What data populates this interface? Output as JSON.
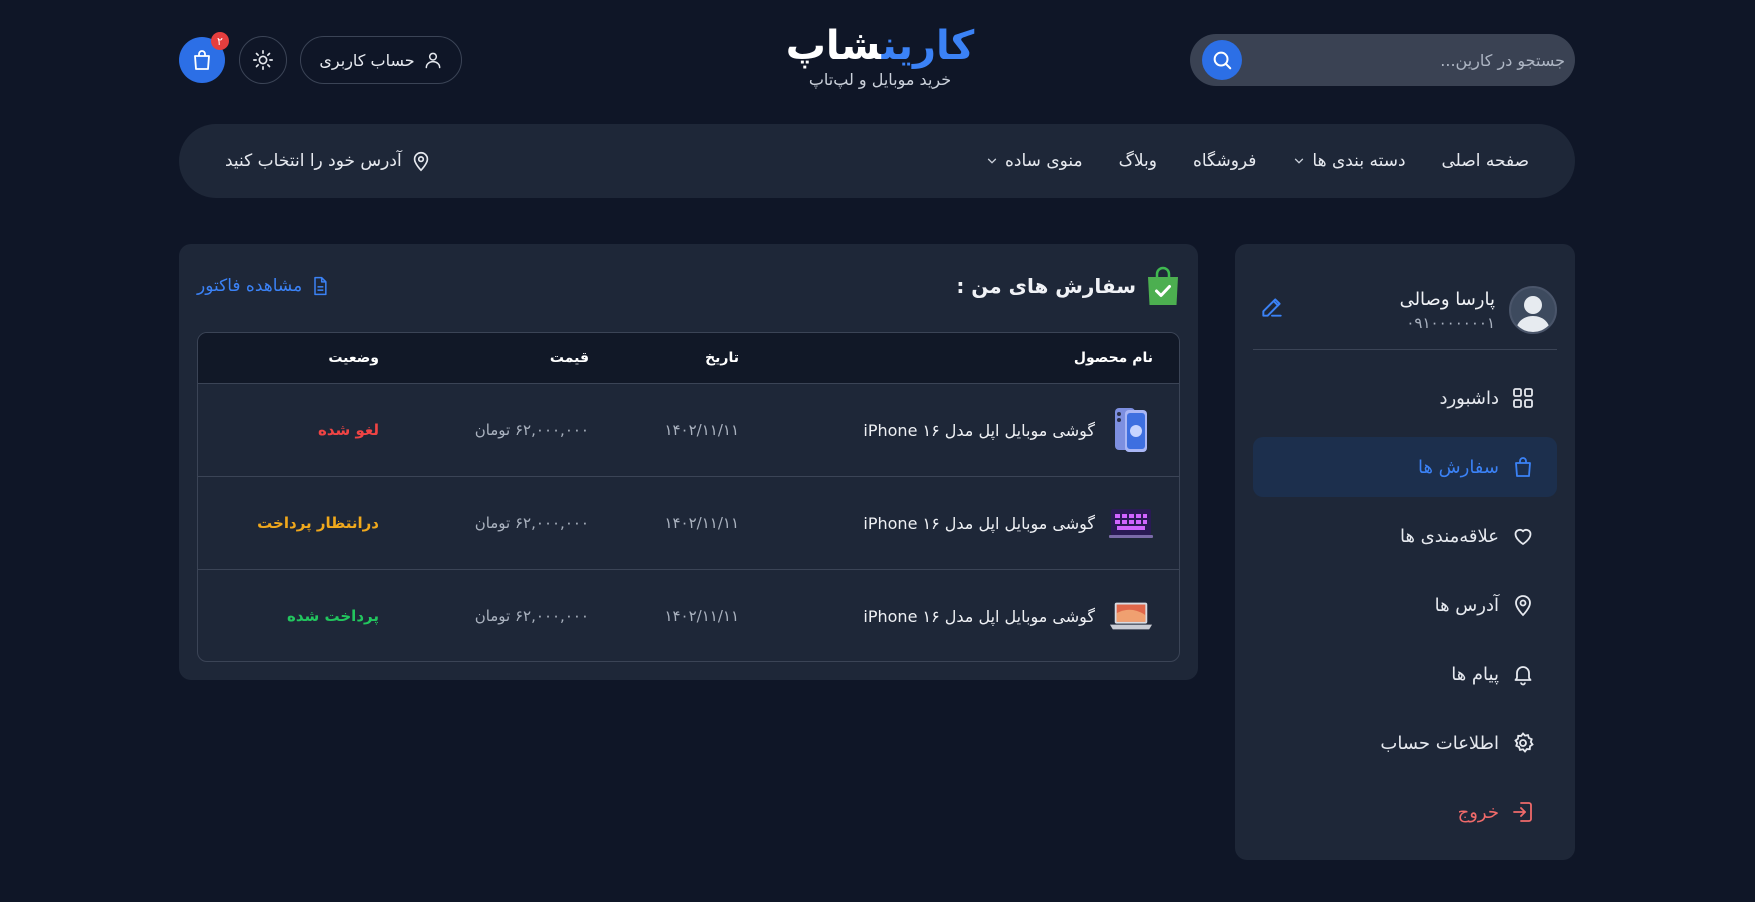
{
  "header": {
    "search_placeholder": "جستجو در کارین...",
    "logo_part1": "کارین",
    "logo_part2": "شاپ",
    "logo_subtitle": "خرید موبایل و لپ‌تاپ",
    "account_label": "حساب کاربری",
    "cart_count": "۲"
  },
  "nav": {
    "items": [
      {
        "label": "صفحه اصلی",
        "has_dropdown": false
      },
      {
        "label": "دسته بندی ها",
        "has_dropdown": true
      },
      {
        "label": "فروشگاه",
        "has_dropdown": false
      },
      {
        "label": "وبلاگ",
        "has_dropdown": false
      },
      {
        "label": "منوی ساده",
        "has_dropdown": true
      }
    ],
    "address_label": "آدرس خود را انتخاب کنید"
  },
  "sidebar": {
    "user_name": "پارسا وصالی",
    "user_phone": "۰۹۱۰۰۰۰۰۰۰۱",
    "menu": [
      {
        "label": "داشبورد",
        "icon": "grid-icon"
      },
      {
        "label": "سفارش ها",
        "icon": "shopping-bag-icon",
        "active": true
      },
      {
        "label": "علاقه‌مندی ها",
        "icon": "heart-icon"
      },
      {
        "label": "آدرس ها",
        "icon": "location-pin-icon"
      },
      {
        "label": "پیام ها",
        "icon": "bell-icon"
      },
      {
        "label": "اطلاعات حساب",
        "icon": "gear-icon"
      },
      {
        "label": "خروج",
        "icon": "logout-icon"
      }
    ]
  },
  "orders": {
    "title": "سفارش های من :",
    "invoice_link": "مشاهده فاکتور",
    "columns": {
      "name": "نام محصول",
      "date": "تاریخ",
      "price": "قیمت",
      "status": "وضعیت"
    },
    "rows": [
      {
        "name": "گوشی موبایل اپل مدل iPhone ۱۶",
        "date": "۱۴۰۲/۱۱/۱۱",
        "price": "۶۲,۰۰۰,۰۰۰ تومان",
        "status": "لغو شده",
        "status_color": "#ef4444",
        "thumb": "phone-thumbnail-icon"
      },
      {
        "name": "گوشی موبایل اپل مدل iPhone ۱۶",
        "date": "۱۴۰۲/۱۱/۱۱",
        "price": "۶۲,۰۰۰,۰۰۰ تومان",
        "status": "درانتظار پرداخت",
        "status_color": "#f0a81c",
        "thumb": "laptop-keyboard-thumbnail-icon"
      },
      {
        "name": "گوشی موبایل اپل مدل iPhone ۱۶",
        "date": "۱۴۰۲/۱۱/۱۱",
        "price": "۶۲,۰۰۰,۰۰۰ تومان",
        "status": "پرداخت شده",
        "status_color": "#22c55e",
        "thumb": "laptop-thumbnail-icon"
      }
    ]
  },
  "colors": {
    "background": "#0f1627",
    "panel": "#1e2738",
    "accent": "#3b82f6"
  }
}
